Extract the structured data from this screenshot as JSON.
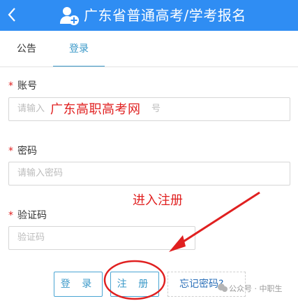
{
  "header": {
    "title": "广东省普通高考/学考报名",
    "bg_color": "#2f8df3",
    "back_icon": "chevron-left-icon",
    "user_icon": "add-user-icon"
  },
  "tabs": [
    {
      "label": "公告",
      "active": false
    },
    {
      "label": "登录",
      "active": true
    }
  ],
  "form": {
    "account_label": "账号",
    "account_placeholder": "请输入",
    "account_placeholder_tail": "号",
    "password_label": "密码",
    "password_placeholder": "请输入密码",
    "captcha_label": "验证码",
    "captcha_placeholder": "验证码",
    "required_mark": "*"
  },
  "overlay_text": {
    "watermark": "广东高职高考网",
    "register_hint": "进入注册"
  },
  "buttons": {
    "login": "登 录",
    "register": "注 册",
    "forgot": "忘记密码?"
  },
  "footer": {
    "credit": "公众号 · 中职生"
  },
  "colors": {
    "accent": "#3a98c8",
    "annotation": "#e02020"
  }
}
